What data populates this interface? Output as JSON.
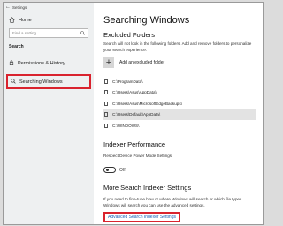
{
  "window": {
    "title": "Settings",
    "back_icon": "back-arrow-icon"
  },
  "sidebar": {
    "home_label": "Home",
    "search_placeholder": "Find a setting",
    "section_title": "Search",
    "items": [
      {
        "label": "Permissions & History",
        "icon": "lock-icon",
        "selected": false
      },
      {
        "label": "Searching Windows",
        "icon": "search-icon",
        "selected": true
      }
    ]
  },
  "main": {
    "page_title": "Searching Windows",
    "excluded": {
      "title": "Excluded Folders",
      "description": "Search will not look in the following folders. Add and remove folders to personalize your search experience.",
      "add_label": "Add an excluded folder",
      "folders": [
        {
          "path": "C:\\ProgramData\\",
          "selected": false
        },
        {
          "path": "C:\\Users\\Asus\\AppData\\",
          "selected": false
        },
        {
          "path": "C:\\Users\\Asus\\MicrosoftEdgeBackups\\",
          "selected": false
        },
        {
          "path": "C:\\Users\\Default\\AppData\\",
          "selected": true
        },
        {
          "path": "C:\\WINDOWS\\",
          "selected": false
        }
      ]
    },
    "indexer_performance": {
      "title": "Indexer Performance",
      "description": "Respect Device Power Mode Settings",
      "toggle_state": "Off"
    },
    "more_settings": {
      "title": "More Search Indexer Settings",
      "description": "If you need to fine-tune how or where Windows will search or which file types Windows will search you can use the advanced settings.",
      "link_label": "Advanced Search Indexer Settings"
    }
  },
  "colors": {
    "highlight_border": "#d9232e",
    "link": "#1a5fb4",
    "sidebar_bg": "#eef0f1"
  }
}
